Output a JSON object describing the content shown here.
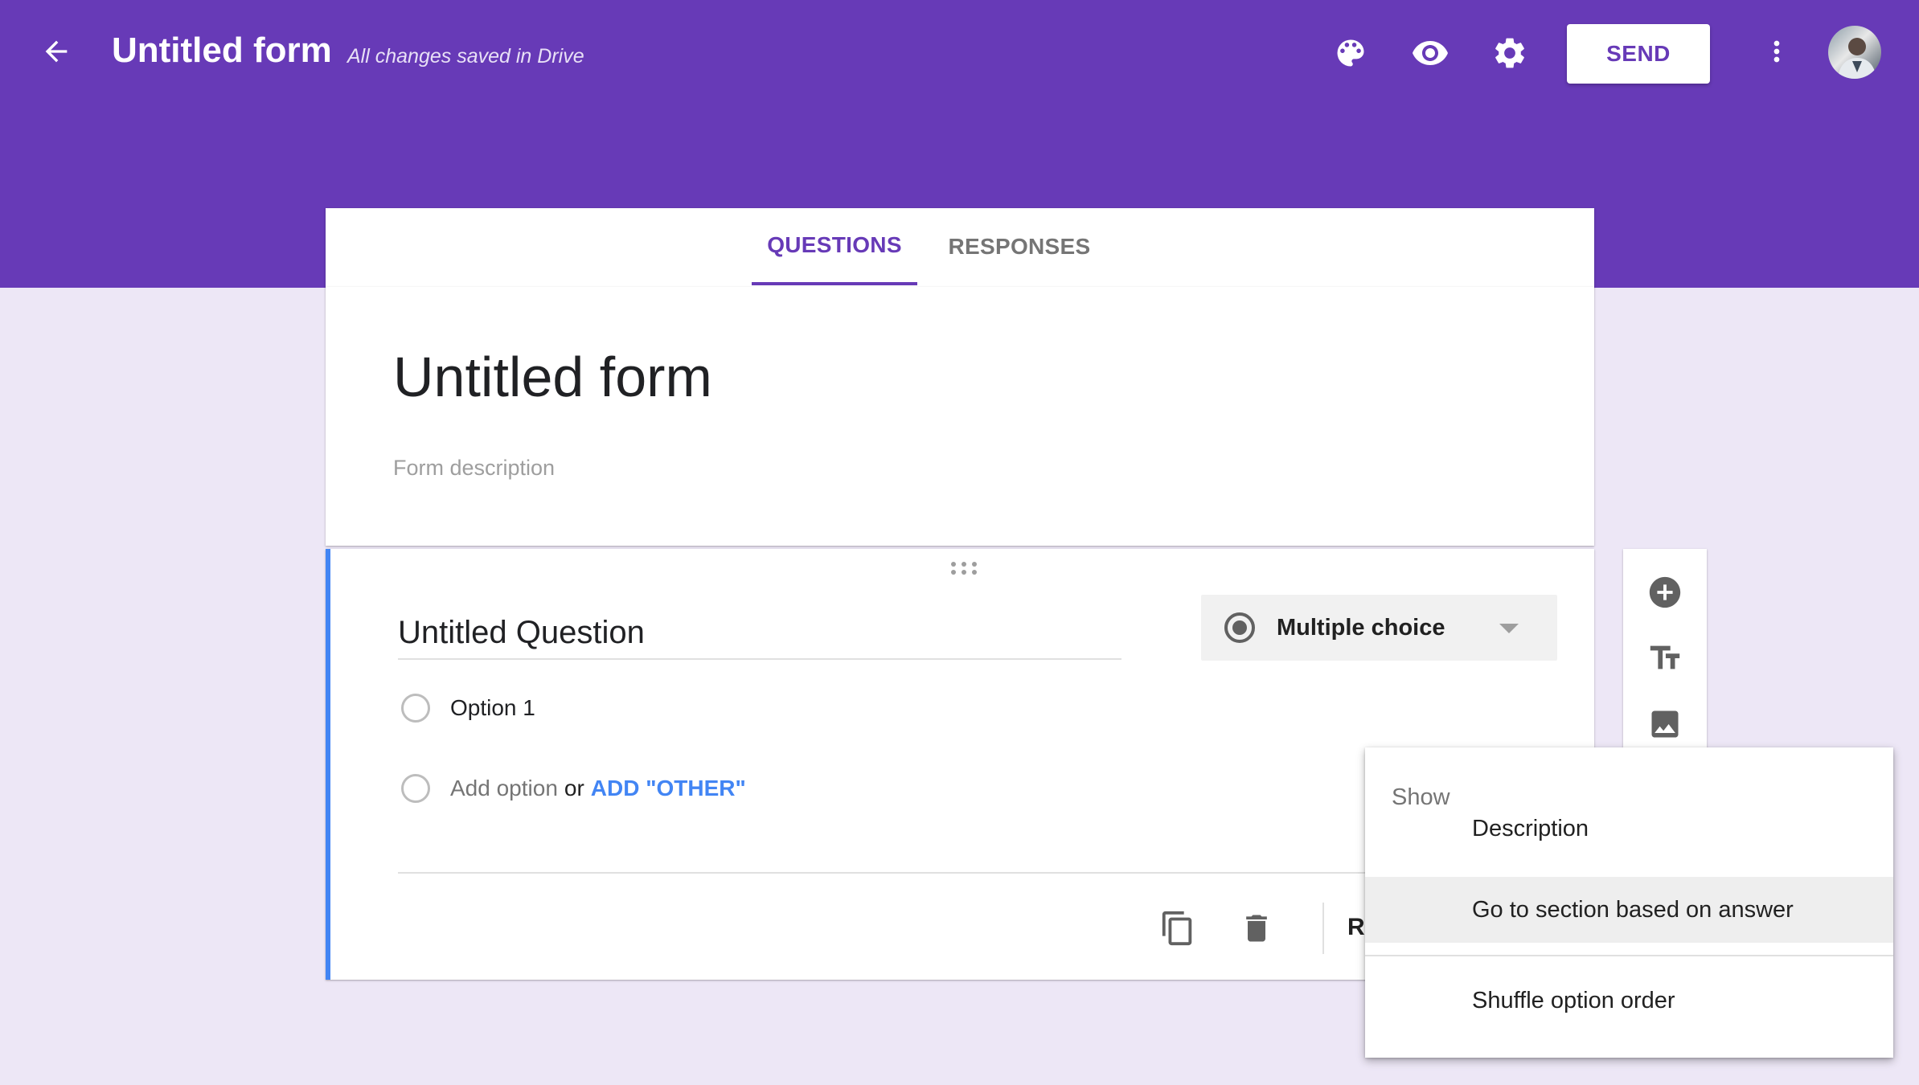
{
  "app_bar": {
    "title": "Untitled form",
    "save_status": "All changes saved in Drive",
    "send_label": "SEND",
    "icons": [
      "back-arrow-icon",
      "palette-icon",
      "eye-icon",
      "gear-icon",
      "more-vert-icon"
    ],
    "brand_color": "#673ab7"
  },
  "tabs": [
    {
      "label": "QUESTIONS",
      "selected": true
    },
    {
      "label": "RESPONSES",
      "selected": false
    }
  ],
  "form": {
    "title": "Untitled form",
    "description_placeholder": "Form description"
  },
  "question": {
    "title": "Untitled Question",
    "type": "Multiple choice",
    "options": [
      "Option 1"
    ],
    "add_option": "Add option",
    "or": "or",
    "add_other": "ADD \"OTHER\"",
    "required_truncated": "Re"
  },
  "menu": {
    "header": "Show",
    "items": [
      {
        "label": "Description",
        "highlighted": false
      },
      {
        "label": "Go to section based on answer",
        "highlighted": true
      },
      {
        "label": "Shuffle option order",
        "highlighted": false
      }
    ]
  },
  "colors": {
    "page_bg": "#ede7f6",
    "accent_blue": "#4285f4"
  }
}
